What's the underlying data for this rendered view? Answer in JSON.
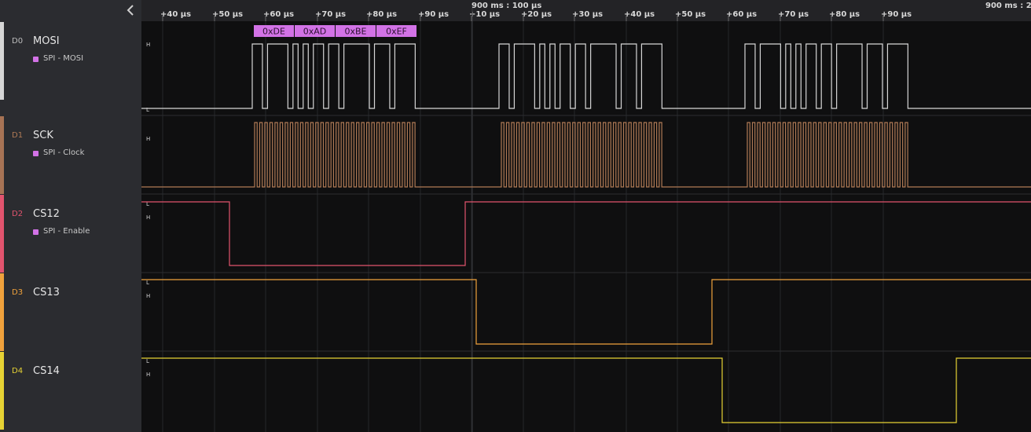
{
  "timeline": {
    "ticks": [
      "+40 µs",
      "+50 µs",
      "+60 µs",
      "+70 µs",
      "+80 µs",
      "+90 µs",
      "+10 µs",
      "+20 µs",
      "+30 µs",
      "+40 µs",
      "+50 µs",
      "+60 µs",
      "+70 µs",
      "+80 µs",
      "+90 µs"
    ],
    "major_label": "900 ms : 100 µs",
    "major_label_2": "900 ms : 20"
  },
  "level_labels": {
    "high": "H",
    "low": "L"
  },
  "channels": [
    {
      "num": "D0",
      "name": "MOSI",
      "analyzer": "SPI - MOSI",
      "color": "#d6d6d6"
    },
    {
      "num": "D1",
      "name": "SCK",
      "analyzer": "SPI - Clock",
      "color": "#b07a55"
    },
    {
      "num": "D2",
      "name": "CS12",
      "analyzer": "SPI - Enable",
      "color": "#e2546e"
    },
    {
      "num": "D3",
      "name": "CS13",
      "color": "#f0a23c"
    },
    {
      "num": "D4",
      "name": "CS14",
      "color": "#e6d234"
    }
  ],
  "analyzer_color": "#d272e6",
  "decoded_bytes": [
    "0xDE",
    "0xAD",
    "0xBE",
    "0xEF"
  ]
}
